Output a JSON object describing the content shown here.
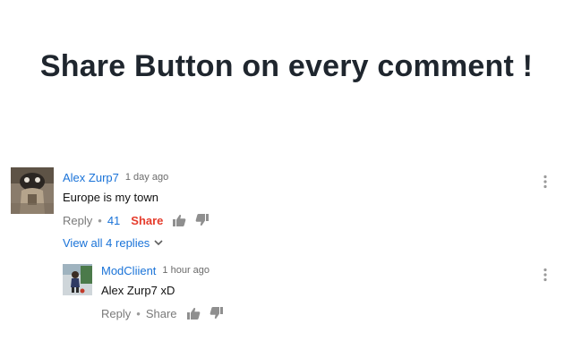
{
  "headline": "Share Button on every comment !",
  "comments": [
    {
      "author": "Alex Zurp7",
      "time": "1 day ago",
      "text": "Europe is my town",
      "reply_label": "Reply",
      "likes": "41",
      "share_label": "Share",
      "view_replies": "View all 4 replies"
    },
    {
      "author": "ModCliient",
      "time": "1 hour ago",
      "text": "Alex Zurp7 xD",
      "reply_label": "Reply",
      "share_label": "Share"
    }
  ],
  "colors": {
    "link_blue": "#1a73d8",
    "share_red": "#e53b2b",
    "muted_gray": "#7a7a7a",
    "headline": "#1f262e"
  },
  "icons": [
    "thumbs-up-icon",
    "thumbs-down-icon",
    "chevron-down-icon",
    "more-vert-icon"
  ]
}
